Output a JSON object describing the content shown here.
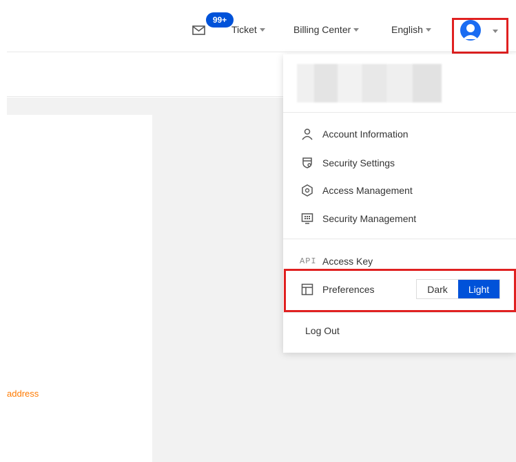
{
  "header": {
    "badge": "99+",
    "nav": [
      {
        "label": "Ticket"
      },
      {
        "label": "Billing Center"
      },
      {
        "label": "English"
      }
    ]
  },
  "content": {
    "card_text": "address"
  },
  "dropdown": {
    "items": [
      {
        "label": "Account Information",
        "icon": "user-icon"
      },
      {
        "label": "Security Settings",
        "icon": "shield-icon"
      },
      {
        "label": "Access Management",
        "icon": "access-icon"
      },
      {
        "label": "Security Management",
        "icon": "monitor-icon"
      }
    ],
    "api_icon_text": "API",
    "api_label": "Access Key",
    "preferences_label": "Preferences",
    "theme_options": {
      "dark": "Dark",
      "light": "Light"
    },
    "selected_theme": "Light",
    "logout_label": "Log Out"
  },
  "colors": {
    "accent": "#0052d9",
    "highlight_border": "#e02020",
    "warning_text": "#ff7a00"
  }
}
